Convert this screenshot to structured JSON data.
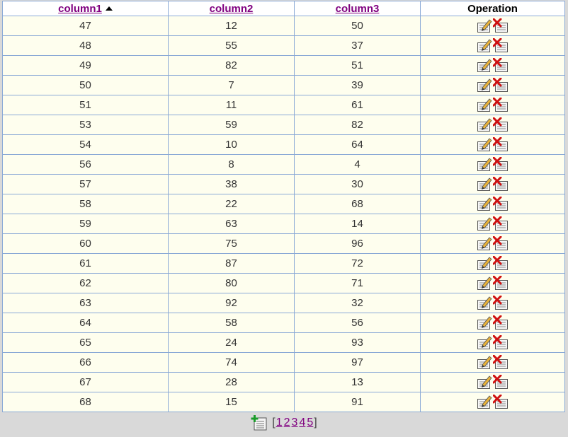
{
  "table": {
    "headers": [
      {
        "label": "column1",
        "link": true,
        "sorted": "asc"
      },
      {
        "label": "column2",
        "link": true
      },
      {
        "label": "column3",
        "link": true
      },
      {
        "label": "Operation",
        "link": false
      }
    ],
    "rows": [
      [
        "47",
        "12",
        "50"
      ],
      [
        "48",
        "55",
        "37"
      ],
      [
        "49",
        "82",
        "51"
      ],
      [
        "50",
        "7",
        "39"
      ],
      [
        "51",
        "11",
        "61"
      ],
      [
        "53",
        "59",
        "82"
      ],
      [
        "54",
        "10",
        "64"
      ],
      [
        "56",
        "8",
        "4"
      ],
      [
        "57",
        "38",
        "30"
      ],
      [
        "58",
        "22",
        "68"
      ],
      [
        "59",
        "63",
        "14"
      ],
      [
        "60",
        "75",
        "96"
      ],
      [
        "61",
        "87",
        "72"
      ],
      [
        "62",
        "80",
        "71"
      ],
      [
        "63",
        "92",
        "32"
      ],
      [
        "64",
        "58",
        "56"
      ],
      [
        "65",
        "24",
        "93"
      ],
      [
        "66",
        "74",
        "97"
      ],
      [
        "67",
        "28",
        "13"
      ],
      [
        "68",
        "15",
        "91"
      ]
    ],
    "row_actions": [
      "edit-icon",
      "delete-icon"
    ]
  },
  "footer": {
    "add_icon": "add-row-icon",
    "bracket_open": "[",
    "bracket_close": "]",
    "pages": [
      "1",
      "2",
      "3",
      "4",
      "5"
    ]
  },
  "colors": {
    "border": "#8aa9d6",
    "row_bg": "#fefeee",
    "link": "#800080",
    "page_bg": "#d9d9d9"
  }
}
